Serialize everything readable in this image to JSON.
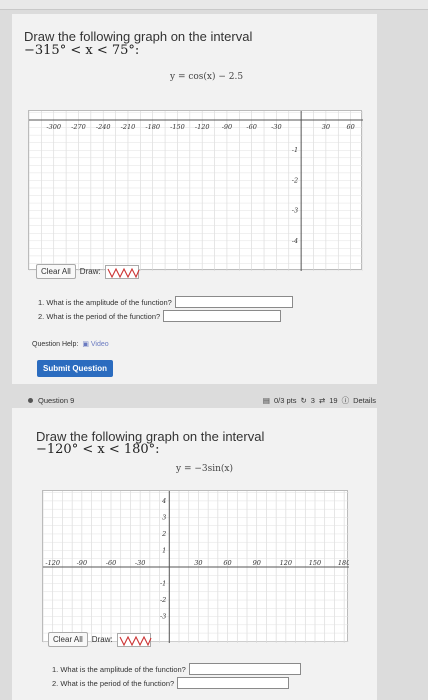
{
  "q1": {
    "prompt": "Draw the following graph on the interval",
    "interval": "−315° < x < 75°:",
    "equation": "y = cos(x) − 2.5",
    "x_ticks": [
      "-300",
      "-270",
      "-240",
      "-210",
      "-180",
      "-150",
      "-120",
      "-90",
      "-60",
      "-30",
      "30",
      "60"
    ],
    "y_ticks": [
      "-1",
      "-2",
      "-3",
      "-4"
    ],
    "clear_label": "Clear All",
    "draw_label": "Draw:",
    "questions": [
      {
        "text": "1. What is the amplitude of the function?",
        "value": ""
      },
      {
        "text": "2. What is the period of the function?",
        "value": ""
      }
    ],
    "help_label": "Question Help:",
    "video_label": "Video",
    "submit_label": "Submit Question"
  },
  "q9header": {
    "label": "Question 9",
    "pts": "0/3 pts",
    "attempts": "3",
    "retries": "19",
    "details": "Details"
  },
  "q2": {
    "prompt": "Draw the following graph on the interval",
    "interval": "−120° < x < 180°:",
    "equation": "y = −3sin(x)",
    "x_ticks": [
      "-120",
      "-90",
      "-60",
      "-30",
      "30",
      "60",
      "90",
      "120",
      "150",
      "180"
    ],
    "y_ticks_pos": [
      "4",
      "3",
      "2",
      "1"
    ],
    "y_ticks_neg": [
      "-1",
      "-2",
      "-3"
    ],
    "clear_label": "Clear All",
    "draw_label": "Draw:",
    "questions": [
      {
        "text": "1. What is the amplitude of the function?",
        "value": ""
      },
      {
        "text": "2. What is the period of the function?",
        "value": ""
      }
    ]
  }
}
